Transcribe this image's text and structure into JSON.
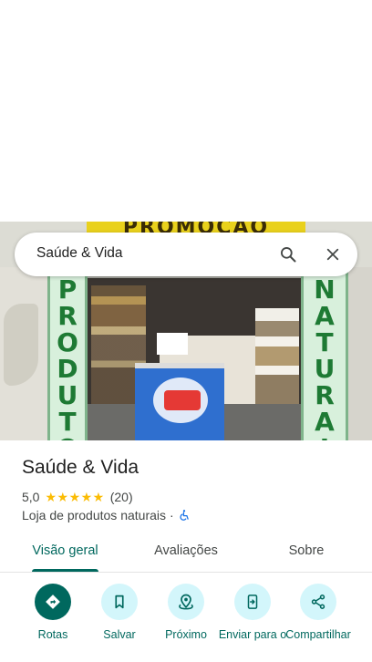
{
  "search": {
    "query": "Saúde & Vida"
  },
  "photo": {
    "banner_text": "PROMOÇÃO",
    "left_sign_text": "PRODUTOS",
    "right_sign_text": "NATURAIS"
  },
  "place": {
    "name": "Saúde & Vida",
    "rating": "5,0",
    "stars": "★★★★★",
    "review_count": "(20)",
    "category": "Loja de produtos naturais",
    "separator": "·"
  },
  "tabs": [
    {
      "label": "Visão geral",
      "active": true
    },
    {
      "label": "Avaliações",
      "active": false
    },
    {
      "label": "Sobre",
      "active": false
    }
  ],
  "actions": [
    {
      "label": "Rotas",
      "icon": "directions-icon"
    },
    {
      "label": "Salvar",
      "icon": "bookmark-icon"
    },
    {
      "label": "Próximo",
      "icon": "nearby-icon"
    },
    {
      "label": "Enviar para o",
      "icon": "send-to-phone-icon"
    },
    {
      "label": "Compartilhar",
      "icon": "share-icon"
    }
  ],
  "colors": {
    "accent": "#00685e",
    "action_bg": "#d3f6fb",
    "star": "#fbbc04",
    "accessibility": "#1a73e8"
  }
}
